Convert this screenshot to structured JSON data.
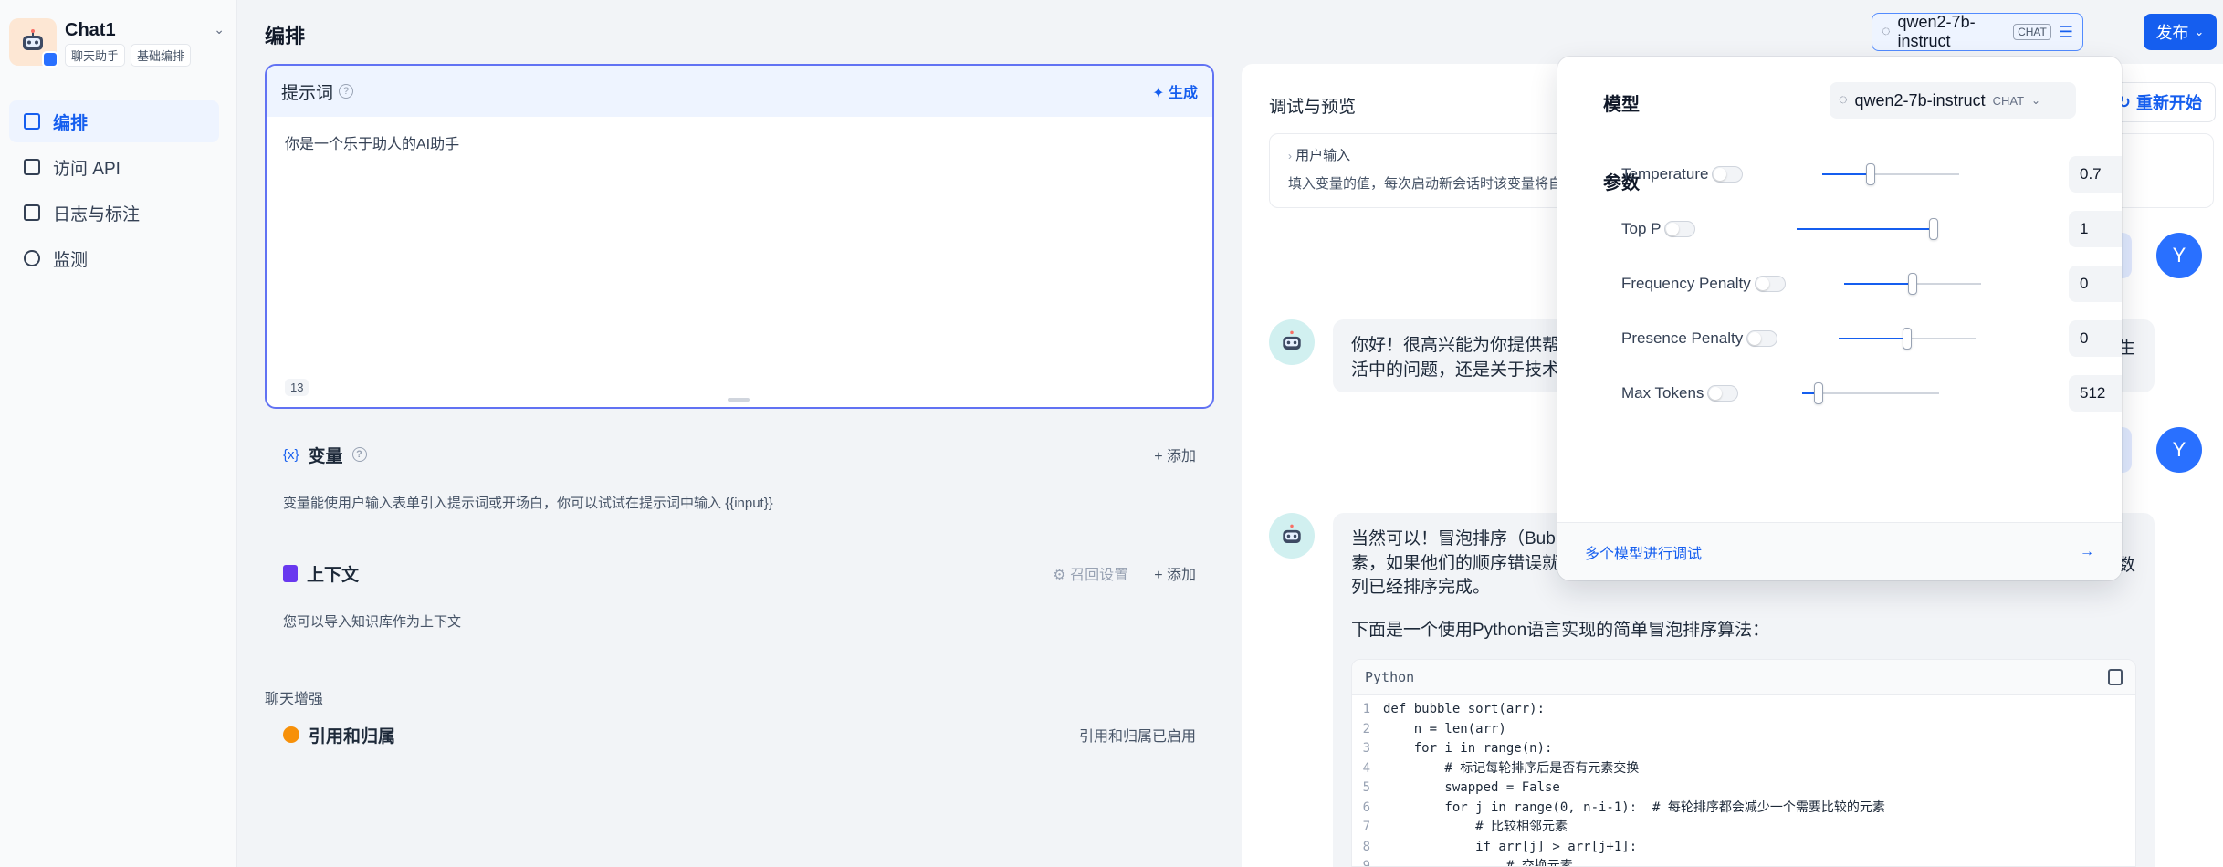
{
  "app": {
    "name": "Chat1",
    "tags": [
      "聊天助手",
      "基础编排"
    ]
  },
  "nav": [
    {
      "label": "编排",
      "icon": "layout-icon",
      "active": true
    },
    {
      "label": "访问 API",
      "icon": "terminal-icon",
      "active": false
    },
    {
      "label": "日志与标注",
      "icon": "file-list-icon",
      "active": false
    },
    {
      "label": "监测",
      "icon": "dashboard-icon",
      "active": false
    }
  ],
  "header": {
    "title": "编排",
    "model_name": "qwen2-7b-instruct",
    "model_type": "CHAT",
    "publish_label": "发布"
  },
  "prompt": {
    "title": "提示词",
    "generate_label": "生成",
    "text": "你是一个乐于助人的AI助手",
    "count": "13"
  },
  "variables": {
    "title": "变量",
    "add_label": "添加",
    "description": "变量能使用户输入表单引入提示词或开场白，你可以试试在提示词中输入 {{input}}"
  },
  "context": {
    "title": "上下文",
    "recall_label": "召回设置",
    "add_label": "添加",
    "description": "您可以导入知识库作为上下文"
  },
  "enhance": {
    "section_label": "聊天增强",
    "citation_title": "引用和归属",
    "citation_status": "引用和归属已启用"
  },
  "preview": {
    "title": "调试与预览",
    "restart_label": "重新开始",
    "user_input_title": "用户输入",
    "user_input_desc": "填入变量的值，每次启动新会话时该变量将自",
    "user_avatar": "Y",
    "bot_msg_1_line1": "你好！很高兴能为你提供帮助",
    "bot_msg_1_line1_end": "生",
    "bot_msg_1_line2": "活中的问题，还是关于技术、",
    "bot_msg_2_line1": "当然可以！冒泡排序（Bubbl",
    "bot_msg_2_line2": "素，如果他们的顺序错误就把",
    "bot_msg_2_line2_end": "数",
    "bot_msg_2_line3": "列已经排序完成。",
    "bot_msg_2_line4": "下面是一个使用Python语言实现的简单冒泡排序算法：",
    "code_lang": "Python",
    "code": [
      {
        "n": "1",
        "t": "def bubble_sort(arr):"
      },
      {
        "n": "2",
        "t": "    n = len(arr)"
      },
      {
        "n": "3",
        "t": "    for i in range(n):"
      },
      {
        "n": "4",
        "t": "        # 标记每轮排序后是否有元素交换"
      },
      {
        "n": "5",
        "t": "        swapped = False"
      },
      {
        "n": "6",
        "t": "        for j in range(0, n-i-1):  # 每轮排序都会减少一个需要比较的元素"
      },
      {
        "n": "7",
        "t": "            # 比较相邻元素"
      },
      {
        "n": "8",
        "t": "            if arr[j] > arr[j+1]:"
      },
      {
        "n": "9",
        "t": "                # 交换元素"
      }
    ]
  },
  "popover": {
    "model_label": "模型",
    "model_name": "qwen2-7b-instruct",
    "model_type": "CHAT",
    "params_label": "参数",
    "params": [
      {
        "name": "Temperature",
        "value": "0.7",
        "fill": 0.35
      },
      {
        "name": "Top P",
        "value": "1",
        "fill": 1.0
      },
      {
        "name": "Frequency Penalty",
        "value": "0",
        "fill": 0.5
      },
      {
        "name": "Presence Penalty",
        "value": "0",
        "fill": 0.5
      },
      {
        "name": "Max Tokens",
        "value": "512",
        "fill": 0.12
      }
    ],
    "footer_label": "多个模型进行调试",
    "footer_arrow": "→"
  }
}
